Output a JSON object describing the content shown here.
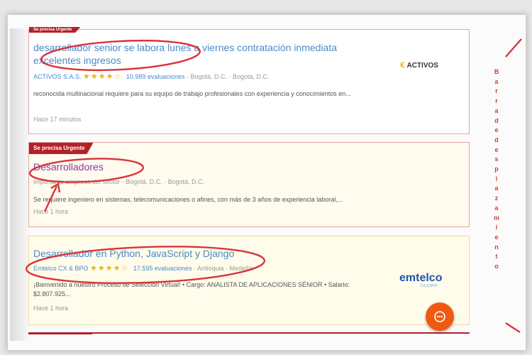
{
  "jobs": [
    {
      "badge": "Se precisa Urgente",
      "title": "desarrollador senior se labora lunes a viernes contratación inmediata excelentes ingresos",
      "company": "ACTIVOS S.A.S.",
      "stars": "★★★★☆",
      "rating": 4,
      "reviews": "10.989 evaluaciones",
      "location": "· Bogotá, D.C. · Bogotá, D.C.",
      "description": "reconocida multinacional requiere para su equipo de trabajo profesionales con experiencia y conocimientos en...",
      "time": "Hace 17 minutos",
      "logo": "ACTIVOS"
    },
    {
      "badge": "Se precisa Urgente",
      "title": "Desarrolladores",
      "company": "Importante empresa del sector",
      "location": "· Bogotá, D.C. · Bogotá, D.C.",
      "description": "Se requiere ingeniero en sistemas, telecomunicaciones o afines, con más de 3 años de experiencia laboral,...",
      "time": "Hace 1 hora"
    },
    {
      "title": "Desarrollador en Python, JavaScript y Django",
      "company": "Emtelco CX & BPO",
      "stars": "★★★★☆",
      "rating": 4,
      "reviews": "17.595 evaluaciones",
      "location": "· Antioquia · Medellín",
      "description": "¡Bienvenido a nuestro Proceso de Selección Virtual! • Cargo: ANALISTA DE APLICACIONES SÉNIOR • Salario: $2.807.925...",
      "time": "Hace 1 hora",
      "logo": "emtelco",
      "logo_sub": "CX & BPO"
    }
  ],
  "side_label": "Barradedesplazamiento",
  "chat_button_icon": "chat-icon",
  "colors": {
    "accent": "#b52026",
    "link": "#4a8ac8",
    "annotation": "#d9343a",
    "chat": "#ef5a12"
  }
}
